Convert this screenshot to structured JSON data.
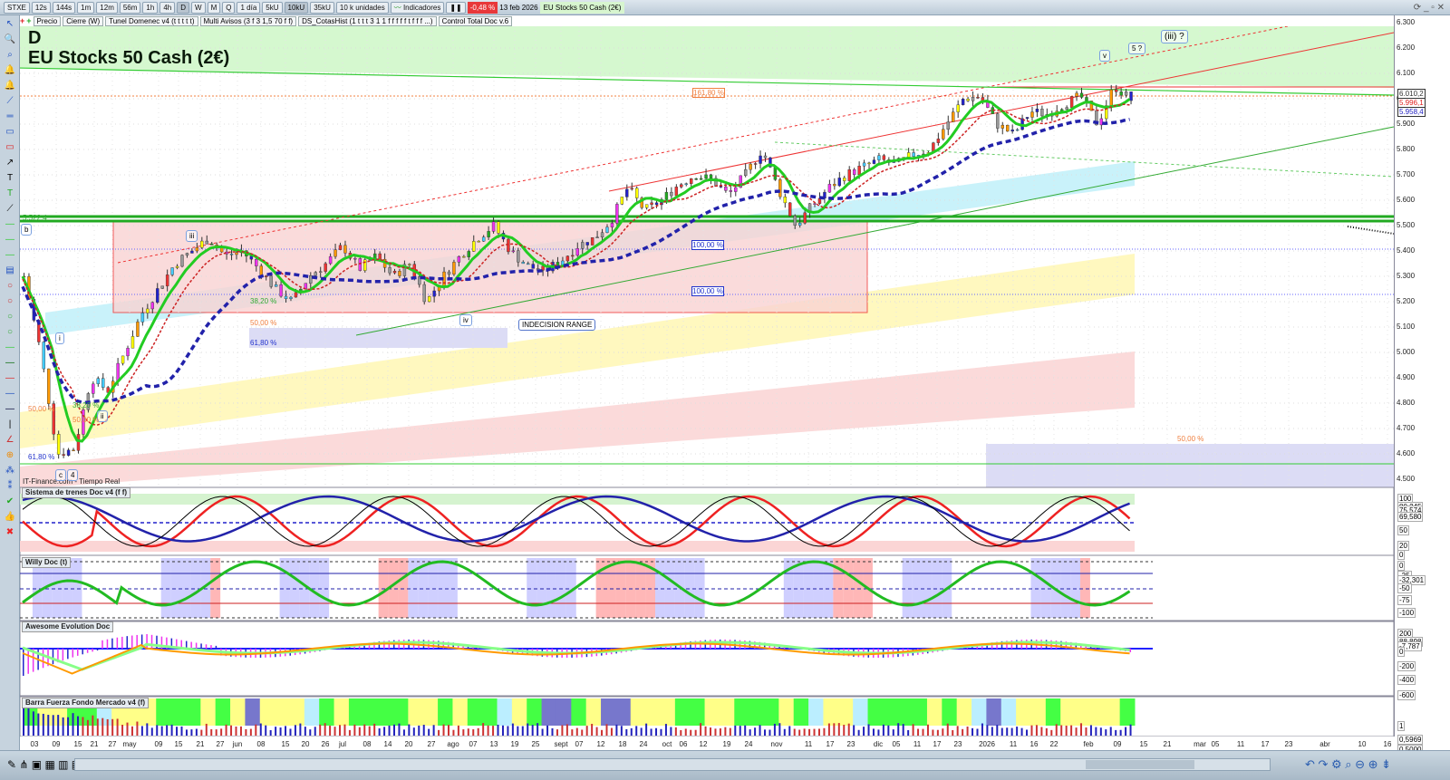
{
  "toolbar": {
    "symbol": "STXE",
    "intervals": [
      "12s",
      "144s",
      "1m",
      "12m",
      "56m",
      "1h",
      "4h",
      "D",
      "W",
      "M",
      "Q"
    ],
    "active_interval": "D",
    "period": "1 día",
    "units": [
      "5kU",
      "10kU",
      "35kU"
    ],
    "active_unit": "10kU",
    "unit_select": "10 k unidades",
    "indicators_label": "Indicadores",
    "change": "-0,48 %",
    "date": "13 feb 2026",
    "instrument": "EU Stocks 50 Cash (2€)"
  },
  "indicator_tags": [
    "Precio",
    "Cierre (W)",
    "Tunel Domenec v4 (t t t t t)",
    "Multi Avisos (3 f 3 1,5 70 f f)",
    "DS_CotasHist (1 t t t 3 1 1 f f f f f t f f f ...)",
    "Control Total Doc v.6"
  ],
  "chart": {
    "timeframe": "D",
    "title": "EU Stocks 50 Cash (2€)",
    "source": "IT-Finance.com - Tiempo Real",
    "annotations": {
      "box_label": "INDECISION RANGE",
      "wave_v": "v",
      "wave_5": "5 ?",
      "wave_iii": "(iii) ?",
      "wave_iii_small": "iii",
      "wave_iv": "iv",
      "wave_i": "i",
      "wave_ii": "ii",
      "wave_b": "b",
      "wave_c": "c",
      "wave_4": "4",
      "fib_161": "161,80 %",
      "fib_100a": "100,00 %",
      "fib_100b": "100,00 %",
      "fib_382a": "38,20 %",
      "fib_500a": "50,00 %",
      "fib_618a": "61,80 %",
      "fib_382b": "38,20 %",
      "fib_500b": "50,00 %",
      "fib_500c": "50,00 %",
      "fib_618b": "61,80 %",
      "fib_500d": "50,00 %",
      "level_left": "5.522,4"
    }
  },
  "price_axis": {
    "ticks": [
      "6.300",
      "6.200",
      "6.100",
      "6.000",
      "5.900",
      "5.800",
      "5.700",
      "5.600",
      "5.500",
      "5.400",
      "5.300",
      "5.200",
      "5.100",
      "5.000",
      "4.900",
      "4.800",
      "4.700",
      "4.600",
      "4.500"
    ],
    "markers": [
      {
        "text": "6.010,2",
        "color": "#333333"
      },
      {
        "text": "5.996,1",
        "color": "#e02020"
      },
      {
        "text": "5.958,4",
        "color": "#2020c0"
      }
    ]
  },
  "panels": [
    {
      "title": "Sistema de trenes Doc v4 (f f)",
      "axis": [
        "100",
        "80,245",
        "75,574",
        "69,580",
        "50",
        "20",
        "0"
      ]
    },
    {
      "title": "Willy Doc (t)",
      "axis": [
        "0",
        "-25",
        "-32,301",
        "-50",
        "-75",
        "-100"
      ]
    },
    {
      "title": "Awesome Evolution Doc",
      "axis": [
        "200",
        "88,898",
        "-7,787",
        "0",
        "-200",
        "-400",
        "-600"
      ]
    },
    {
      "title": "Barra Fuerza Fondo Mercado v4 (f)",
      "axis": [
        "1",
        "0,5969",
        "0,5000"
      ]
    }
  ],
  "x_axis": [
    "03",
    "09",
    "15",
    "21",
    "27",
    "may",
    "09",
    "15",
    "21",
    "27",
    "jun",
    "08",
    "15",
    "20",
    "26",
    "jul",
    "08",
    "14",
    "20",
    "27",
    "ago",
    "07",
    "13",
    "19",
    "25",
    "sept",
    "07",
    "12",
    "18",
    "24",
    "oct",
    "06",
    "12",
    "19",
    "24",
    "nov",
    "11",
    "17",
    "23",
    "dic",
    "05",
    "11",
    "17",
    "23",
    "2026",
    "11",
    "16",
    "22",
    "feb",
    "09",
    "15",
    "21",
    "mar",
    "05",
    "11",
    "17",
    "23",
    "abr",
    "10",
    "16"
  ],
  "chart_data": {
    "type": "candlestick",
    "ylim": [
      4500,
      6300
    ],
    "closes": [
      5300,
      5000,
      4600,
      4620,
      4900,
      4850,
      5000,
      5150,
      5250,
      5350,
      5400,
      5450,
      5380,
      5400,
      5330,
      5250,
      5200,
      5300,
      5350,
      5420,
      5330,
      5380,
      5300,
      5350,
      5200,
      5300,
      5380,
      5450,
      5500,
      5400,
      5340,
      5320,
      5360,
      5420,
      5450,
      5520,
      5650,
      5560,
      5600,
      5660,
      5700,
      5680,
      5620,
      5700,
      5800,
      5640,
      5500,
      5580,
      5650,
      5700,
      5730,
      5760,
      5740,
      5780,
      5800,
      5900,
      6000,
      6010,
      5900,
      5860,
      5950,
      5940,
      5980,
      6010,
      5900,
      6050,
      5996
    ]
  },
  "colors": {
    "accent": "#2a5db0",
    "change_bg": "#e8383a",
    "green_zone": "#d5f8cf",
    "pink_zone": "#f9d3d3"
  }
}
